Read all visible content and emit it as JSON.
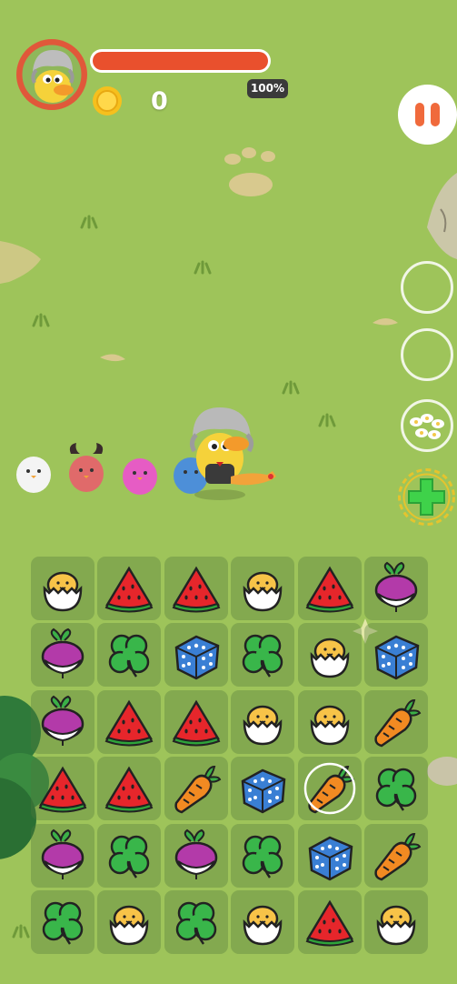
{
  "hud": {
    "health_percent_label": "100%",
    "health_fraction": 1.0,
    "coin_count": "0",
    "avatar_icon": "duck-avatar-icon",
    "coin_icon": "coin-icon",
    "pause_icon": "pause-icon"
  },
  "skills": {
    "slots": [
      "empty-slot",
      "empty-slot",
      "daisy-flower-icon",
      "green-cross-heal-icon"
    ]
  },
  "colors": {
    "grass": "#9ec45a",
    "health": "#e9502d",
    "pause": "#f06a3c",
    "tile": "#5b8a3e"
  },
  "board": {
    "rows": [
      [
        "egg",
        "watermelon",
        "watermelon",
        "egg",
        "watermelon",
        "turnip"
      ],
      [
        "turnip",
        "clover",
        "dice",
        "clover",
        "egg",
        "dice"
      ],
      [
        "turnip",
        "watermelon",
        "watermelon",
        "egg",
        "egg",
        "carrot"
      ],
      [
        "watermelon",
        "watermelon",
        "carrot",
        "dice",
        "carrot",
        "clover"
      ],
      [
        "turnip",
        "clover",
        "turnip",
        "clover",
        "dice",
        "carrot"
      ],
      [
        "clover",
        "egg",
        "clover",
        "egg",
        "watermelon",
        "egg"
      ]
    ],
    "selected": [
      3,
      4
    ]
  }
}
